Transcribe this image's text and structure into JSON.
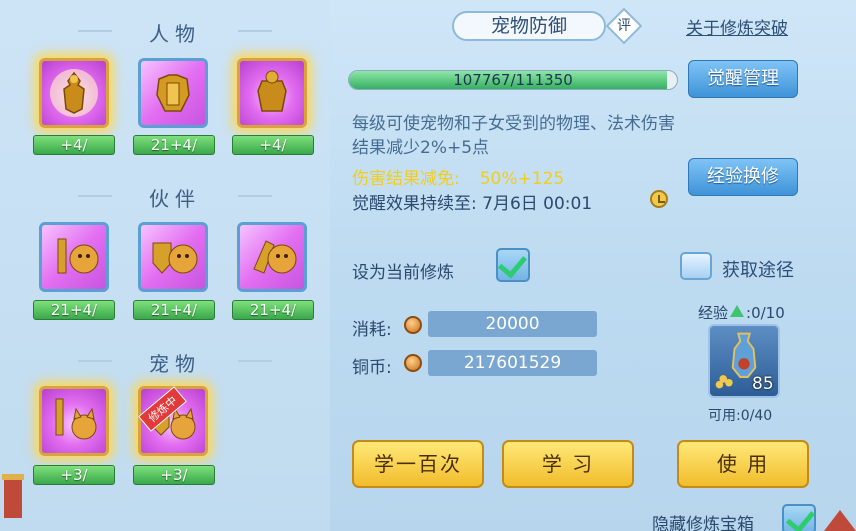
{
  "sections": {
    "character": "人物",
    "partner": "伙伴",
    "pet": "宠物"
  },
  "character_slots": [
    {
      "icon": "golden-warrior-icon",
      "level": "+4/"
    },
    {
      "icon": "golden-armor-icon",
      "level": "21+4/"
    },
    {
      "icon": "golden-guardian-icon",
      "level": "+4/"
    }
  ],
  "partner_slots": [
    {
      "icon": "sword-and-tiger-icon",
      "level": "21+4/"
    },
    {
      "icon": "shield-and-tiger-icon",
      "level": "21+4/"
    },
    {
      "icon": "gauntlet-and-tiger-icon",
      "level": "21+4/"
    }
  ],
  "pet_slots": [
    {
      "icon": "sword-and-cat-icon",
      "level": "+3/"
    },
    {
      "icon": "shield-and-cat-icon",
      "level": "+3/",
      "tag": "修炼中"
    }
  ],
  "header": {
    "title": "宠物防御",
    "rate": "评",
    "link": "关于修炼突破"
  },
  "progress": {
    "text": "107767/111350",
    "fraction": 0.968
  },
  "buttons": {
    "awaken_manage": "觉醒管理",
    "exp_exchange": "经验换修",
    "learn_hundred": "学一百次",
    "learn": "学 习",
    "use": "使 用"
  },
  "description": "每级可使宠物和子女受到的物理、法术伤害结果减少2%+5点",
  "reduction": {
    "label": "伤害结果减免:",
    "value": "50%+125"
  },
  "awaken_until": "觉醒效果持续至:  7月6日 00:01",
  "set_current": "设为当前修炼",
  "acquire": "获取途径",
  "cost": {
    "label": "消耗:",
    "value": "20000"
  },
  "copper": {
    "label": "铜币:",
    "value": "217601529"
  },
  "exp": {
    "label": "经验",
    "value": ":0/10"
  },
  "item": {
    "icon": "golden-vase-icon",
    "count": "85",
    "usable": "可用:0/40"
  },
  "hide_label": "隐藏修炼宝箱",
  "colors": {
    "accent_blue": "#3f93d8",
    "gold_button": "#f1bd2c",
    "highlight_yellow": "#f4cd1a",
    "progress_green": "#36b061"
  }
}
